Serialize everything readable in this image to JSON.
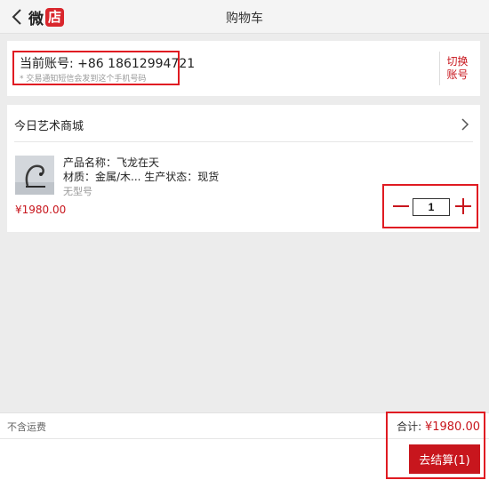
{
  "header": {
    "logo_wei": "微",
    "logo_dian": "店",
    "title": "购物车"
  },
  "account": {
    "label": "当前账号: +86 18612994721",
    "note": "* 交易通知短信会发到这个手机号码",
    "switch_line1": "切换",
    "switch_line2": "账号"
  },
  "shop": {
    "name": "今日艺术商城",
    "product": {
      "name": "产品名称：飞龙在天",
      "meta": "材质：金属/木... 生产状态：现货",
      "model": "无型号",
      "price": "¥1980.00",
      "quantity": "1"
    }
  },
  "footer": {
    "shipping_note": "不含运费",
    "total_label": "合计: ",
    "total_amount": "¥1980.00",
    "checkout_label": "去结算(1)"
  },
  "colors": {
    "accent": "#c8161d",
    "highlight_box": "#e01b22"
  }
}
